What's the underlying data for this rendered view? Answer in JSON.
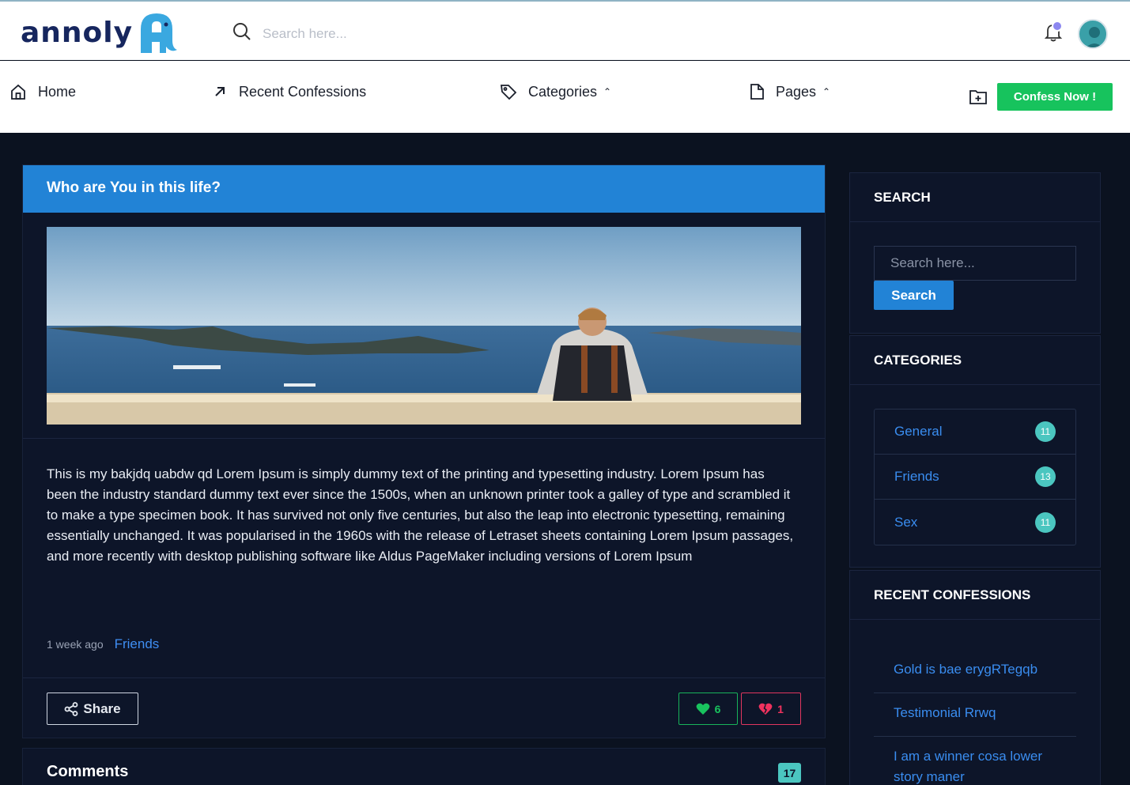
{
  "header": {
    "logo_text": "annoly",
    "search_placeholder": "Search here..."
  },
  "nav": {
    "items": [
      {
        "label": "Home"
      },
      {
        "label": "Recent Confessions"
      },
      {
        "label": "Categories"
      },
      {
        "label": "Pages"
      }
    ],
    "confess_label": "Confess Now !"
  },
  "post": {
    "title": "Who are You in this life?",
    "body": "This is my bakjdq uabdw qd Lorem Ipsum is simply dummy text of the printing and typesetting industry. Lorem Ipsum has been the industry standard dummy text ever since the 1500s, when an unknown printer took a galley of type and scrambled it to make a type specimen book. It has survived not only five centuries, but also the leap into electronic typesetting, remaining essentially unchanged. It was popularised in the 1960s with the release of Letraset sheets containing Lorem Ipsum passages, and more recently with desktop publishing software like Aldus PageMaker including versions of Lorem Ipsum",
    "time": "1 week ago",
    "category": "Friends",
    "share_label": "Share",
    "likes": "6",
    "dislikes": "1"
  },
  "comments": {
    "title": "Comments",
    "count": "17"
  },
  "sidebar": {
    "search": {
      "title": "SEARCH",
      "placeholder": "Search here...",
      "button": "Search"
    },
    "categories": {
      "title": "CATEGORIES",
      "items": [
        {
          "name": "General",
          "count": "11"
        },
        {
          "name": "Friends",
          "count": "13"
        },
        {
          "name": "Sex",
          "count": "11"
        }
      ]
    },
    "recent": {
      "title": "RECENT CONFESSIONS",
      "items": [
        {
          "label": "Gold is bae erygRTegqb"
        },
        {
          "label": "Testimonial Rrwq"
        },
        {
          "label": "I am a winner cosa lower story maner"
        }
      ]
    }
  }
}
